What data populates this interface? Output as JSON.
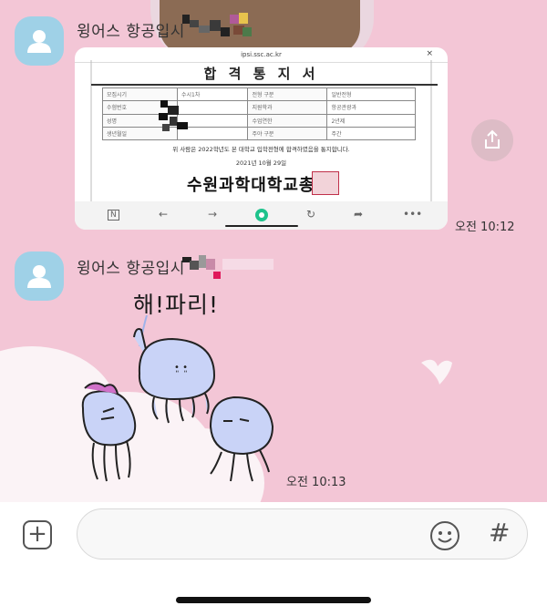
{
  "messages": [
    {
      "sender": "윙어스 항공입시",
      "time": "오전 10:12",
      "image": {
        "url": "ipsi.ssc.ac.kr",
        "close": "×",
        "title": "합 격 통 지 서",
        "table": [
          [
            "모집시기",
            "수시1차",
            "전형 구분",
            "일반전형"
          ],
          [
            "수험번호",
            "",
            "지원학과",
            "항공관광과"
          ],
          [
            "성명",
            "",
            "수업연한",
            "2년제"
          ],
          [
            "생년월일",
            "",
            "주야 구분",
            "주간"
          ]
        ],
        "notice": "위 사람은 2022학년도 본 대학교 입학전형에 합격하였음을 통지합니다.",
        "date": "2021년 10월 29일",
        "signature": "수원과학대학교총장"
      }
    },
    {
      "sender": "윙어스 항공입시",
      "time": "오전 10:13",
      "sticker_text": "해!파리!"
    }
  ],
  "composer": {
    "placeholder": ""
  },
  "icons": {
    "attach": "plus-icon",
    "emoji": "emoticon-icon",
    "hashtag": "hash-icon",
    "share": "share-icon",
    "avatar": "default-profile-icon"
  },
  "colors": {
    "chat_background": "#f3c6d6",
    "avatar": "#9fd1e7",
    "stamp": "#c0304a"
  }
}
